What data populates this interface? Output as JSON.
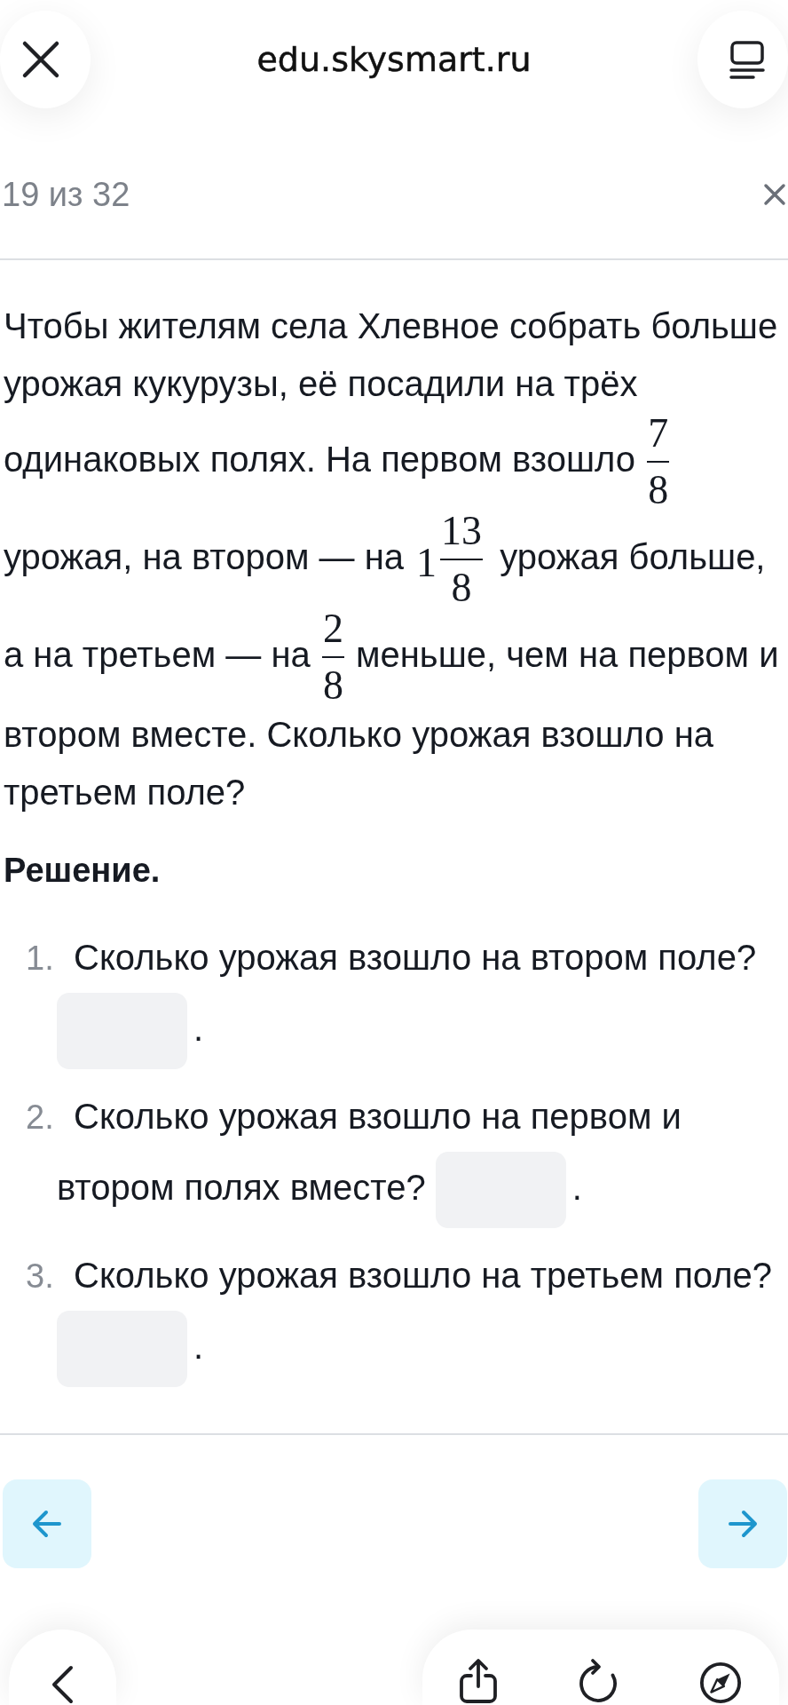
{
  "browser": {
    "url": "edu.skysmart.ru"
  },
  "task": {
    "progress": "19 из 32"
  },
  "problem": {
    "segments": [
      {
        "kind": "text",
        "text": "Чтобы жителям села Хлевное собрать больше урожая кукурузы, её посадили на трёх одинаковых полях. На первом взошло "
      },
      {
        "kind": "fraction",
        "numerator": "7",
        "denominator": "8"
      },
      {
        "kind": "text",
        "text": " урожая, на втором — на "
      },
      {
        "kind": "fraction",
        "whole": "1",
        "numerator": "13",
        "denominator": "8"
      },
      {
        "kind": "text",
        "text": " урожая больше, а на третьем — на "
      },
      {
        "kind": "fraction",
        "numerator": "2",
        "denominator": "8"
      },
      {
        "kind": "text",
        "text": " меньше, чем на первом и втором вместе. Сколько урожая взошло на третьем поле?"
      }
    ]
  },
  "solution": {
    "heading": "Решение.",
    "steps": [
      {
        "number": "1.",
        "question_lines": [
          "Сколько урожая взошло на втором поле?"
        ],
        "after": "."
      },
      {
        "number": "2.",
        "question_lines": [
          "Сколько урожая взошло на первом и",
          "втором полях вместе?"
        ],
        "after": "."
      },
      {
        "number": "3.",
        "question_lines": [
          "Сколько урожая взошло на третьем поле?"
        ],
        "after": "."
      }
    ]
  }
}
